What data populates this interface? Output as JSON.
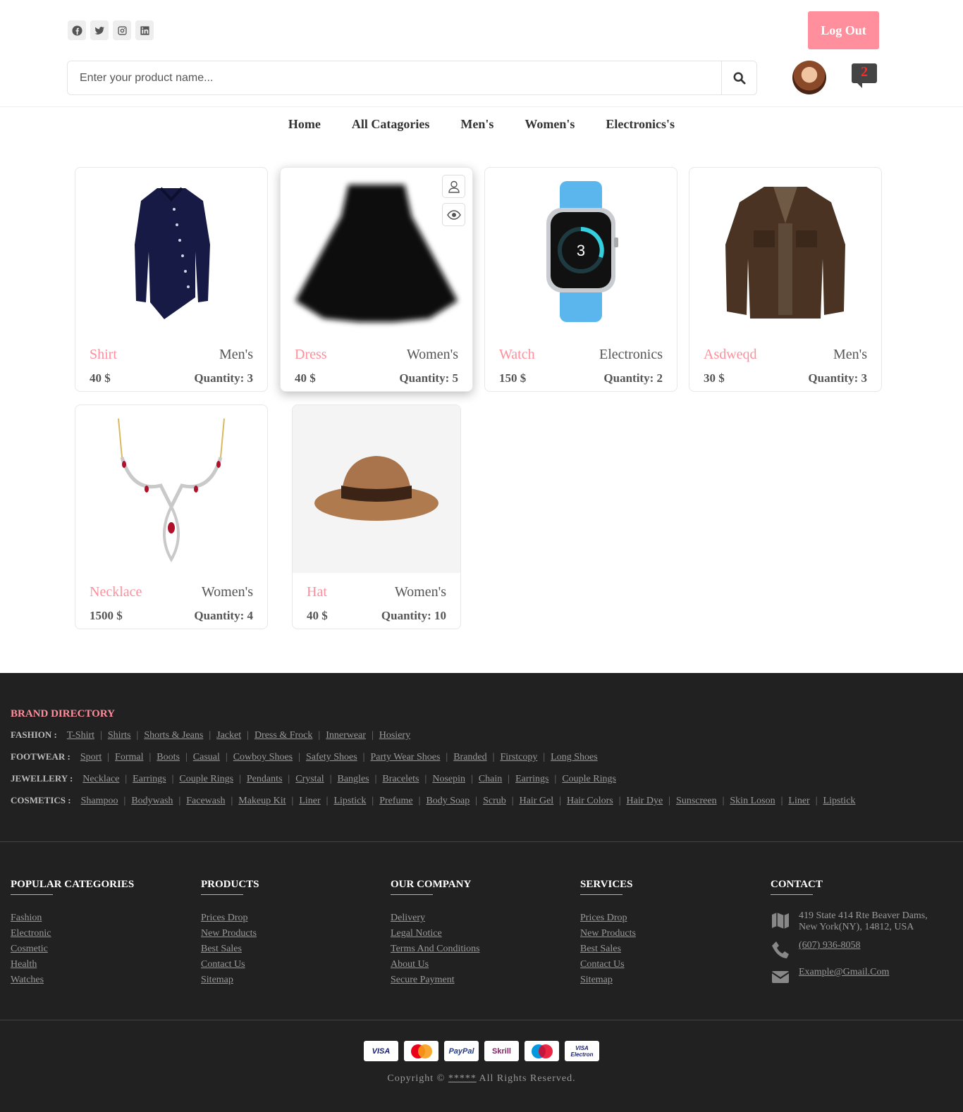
{
  "header": {
    "socials": [
      "facebook-icon",
      "twitter-icon",
      "instagram-icon",
      "linkedin-icon"
    ],
    "logout_label": "Log Out",
    "search_placeholder": "Enter your product name...",
    "notification_count": "2"
  },
  "nav": [
    "Home",
    "All Catagories",
    "Men's",
    "Women's",
    "Electronics's"
  ],
  "products": [
    {
      "name": "Shirt",
      "category": "Men's",
      "price": "40 $",
      "quantity": "Quantity: 3"
    },
    {
      "name": "Dress",
      "category": "Women's",
      "price": "40 $",
      "quantity": "Quantity: 5"
    },
    {
      "name": "Watch",
      "category": "Electronics",
      "price": "150 $",
      "quantity": "Quantity: 2"
    },
    {
      "name": "Asdweqd",
      "category": "Men's",
      "price": "30 $",
      "quantity": "Quantity: 3"
    },
    {
      "name": "Necklace",
      "category": "Women's",
      "price": "1500 $",
      "quantity": "Quantity: 4"
    },
    {
      "name": "Hat",
      "category": "Women's",
      "price": "40 $",
      "quantity": "Quantity: 10"
    }
  ],
  "footer": {
    "brand_title": "BRAND DIRECTORY",
    "brand_rows": [
      {
        "label": "FASHION :",
        "links": [
          "T-Shirt",
          "Shirts",
          "Shorts & Jeans",
          "Jacket",
          "Dress & Frock",
          "Innerwear",
          "Hosiery"
        ]
      },
      {
        "label": "FOOTWEAR :",
        "links": [
          "Sport",
          "Formal",
          "Boots",
          "Casual",
          "Cowboy Shoes",
          "Safety Shoes",
          "Party Wear Shoes",
          "Branded",
          "Firstcopy",
          "Long Shoes"
        ]
      },
      {
        "label": "JEWELLERY :",
        "links": [
          "Necklace",
          "Earrings",
          "Couple Rings",
          "Pendants",
          "Crystal",
          "Bangles",
          "Bracelets",
          "Nosepin",
          "Chain",
          "Earrings",
          "Couple Rings"
        ]
      },
      {
        "label": "COSMETICS :",
        "links": [
          "Shampoo",
          "Bodywash",
          "Facewash",
          "Makeup Kit",
          "Liner",
          "Lipstick",
          "Prefume",
          "Body Soap",
          "Scrub",
          "Hair Gel",
          "Hair Colors",
          "Hair Dye",
          "Sunscreen",
          "Skin Loson",
          "Liner",
          "Lipstick"
        ]
      }
    ],
    "columns": [
      {
        "title": "POPULAR CATEGORIES",
        "links": [
          "Fashion",
          "Electronic",
          "Cosmetic",
          "Health",
          "Watches"
        ]
      },
      {
        "title": "PRODUCTS",
        "links": [
          "Prices Drop",
          "New Products",
          "Best Sales",
          "Contact Us",
          "Sitemap"
        ]
      },
      {
        "title": "OUR COMPANY",
        "links": [
          "Delivery",
          "Legal Notice",
          "Terms And Conditions",
          "About Us",
          "Secure Payment"
        ]
      },
      {
        "title": "SERVICES",
        "links": [
          "Prices Drop",
          "New Products",
          "Best Sales",
          "Contact Us",
          "Sitemap"
        ]
      }
    ],
    "contact": {
      "title": "CONTACT",
      "address": "419 State 414 Rte Beaver Dams, New York(NY), 14812, USA",
      "phone": "(607) 936-8058",
      "email": "Example@Gmail.Com"
    },
    "payments": [
      "VISA",
      "MasterCard",
      "PayPal",
      "Skrill",
      "Maestro",
      "VISA Electron"
    ],
    "copyright_pre": "Copyright ©",
    "copyright_link": "*****",
    "copyright_post": "All Rights Reserved."
  },
  "colors": {
    "accent": "#ff8f9c",
    "footer_bg": "#212121"
  }
}
